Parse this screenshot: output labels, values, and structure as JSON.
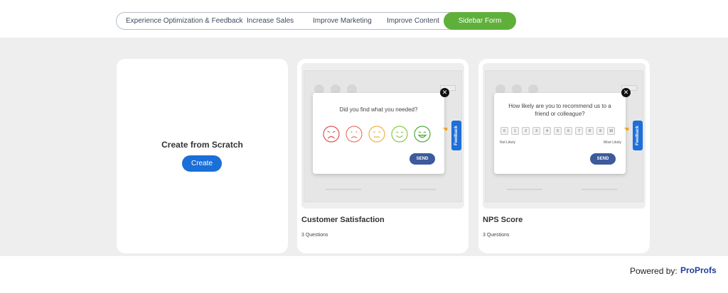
{
  "tabs": [
    {
      "label": "Experience Optimization & Feedback"
    },
    {
      "label": "Increase Sales"
    },
    {
      "label": "Improve Marketing"
    },
    {
      "label": "Improve Content"
    },
    {
      "label": "Sidebar Form",
      "active": true
    }
  ],
  "scratch": {
    "title": "Create from Scratch",
    "button": "Create"
  },
  "csat": {
    "question": "Did you find what you needed?",
    "faces": [
      "very-sad-face-icon",
      "sad-face-icon",
      "neutral-face-icon",
      "smile-face-icon",
      "happy-face-icon"
    ],
    "send": "SEND",
    "feedback_tab": "Feedback",
    "title": "Customer Satisfaction",
    "subtitle": "3 Questions"
  },
  "nps": {
    "question_line1": "How likely are you to recommend us to a",
    "question_line2": "friend or colleague?",
    "scale": [
      "0",
      "1",
      "2",
      "3",
      "4",
      "5",
      "6",
      "7",
      "8",
      "9",
      "10"
    ],
    "low_label": "Not Likely",
    "high_label": "Most Likely",
    "send": "SEND",
    "feedback_tab": "Feedback",
    "title": "NPS Score",
    "subtitle": "3 Questions"
  },
  "footer": {
    "powered": "Powered by:",
    "brand": "ProProfs"
  },
  "colors": {
    "accent_green": "#5fb03b",
    "primary_blue": "#1a6fd8",
    "send_blue": "#3d5a9c",
    "brand_blue": "#1f3d99"
  }
}
